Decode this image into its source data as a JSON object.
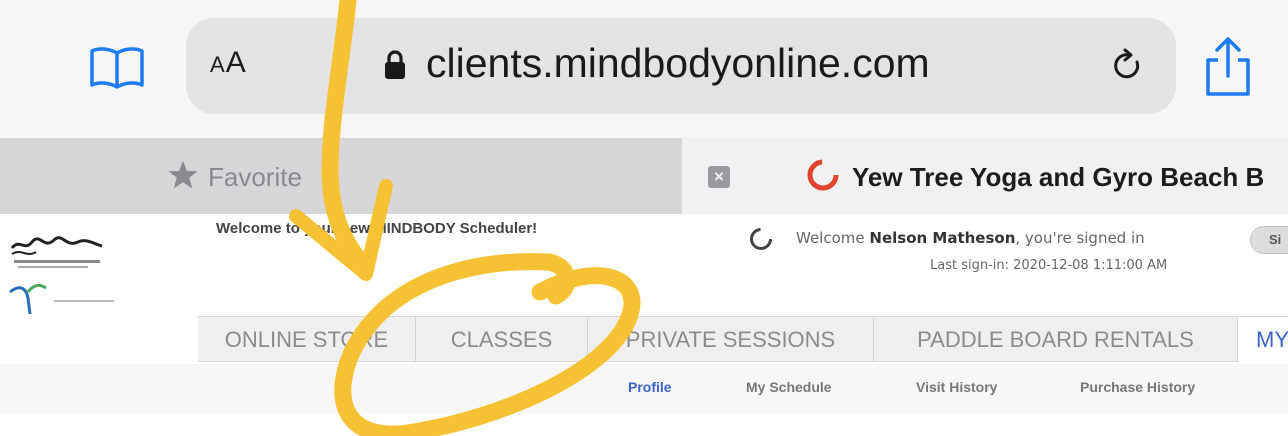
{
  "browser": {
    "reader_text_small": "A",
    "reader_text_large": "A",
    "url": "clients.mindbodyonline.com",
    "icons": [
      "book-icon",
      "lock-icon",
      "reload-icon",
      "share-icon",
      "star-icon",
      "close-icon"
    ]
  },
  "tabs": {
    "favorites_label": "Favorite",
    "active_title": "Yew Tree Yoga and Gyro Beach B"
  },
  "page": {
    "welcome_banner": "Welcome to your new MINDBODY Scheduler!",
    "welcome_prefix": "Welcome ",
    "user_name": "Nelson Matheson",
    "welcome_suffix": ", you're signed in",
    "last_signin": "Last sign-in: 2020-12-08 1:11:00 AM",
    "signout_label": "Si",
    "nav_tabs": [
      "ONLINE STORE",
      "CLASSES",
      "PRIVATE SESSIONS",
      "PADDLE BOARD RENTALS",
      "MY"
    ],
    "sub_links": [
      "Profile",
      "My Schedule",
      "Visit History",
      "Purchase History"
    ],
    "active_sub_link": "Profile"
  },
  "colors": {
    "accent_blue": "#1e7cf2",
    "annotation_yellow": "#f6c234",
    "active_link": "#3d63c9"
  }
}
